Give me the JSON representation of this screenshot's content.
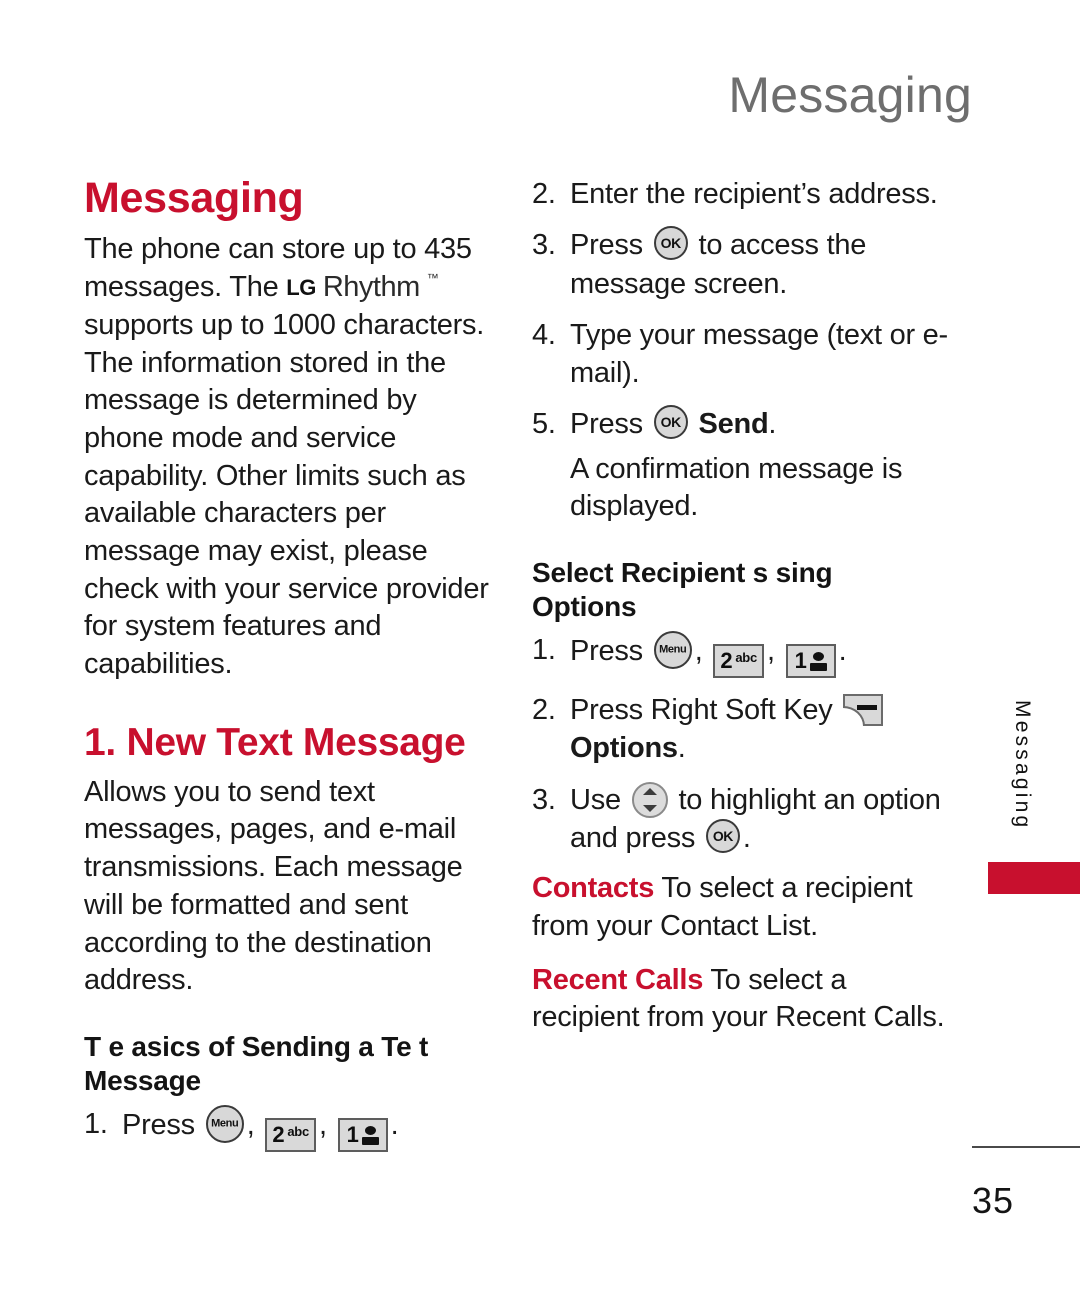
{
  "document": {
    "running_header": "Messaging",
    "page_number": "35",
    "side_tab_label": "Messaging",
    "accent_color": "#C8102E",
    "header_color": "#6E6E6E"
  },
  "left_column": {
    "section_title": "Messaging",
    "intro_before_logo": "The phone can store up to 435 messages. The",
    "logo": {
      "mark": "LG",
      "word": "Rhythm",
      "trademark": "™"
    },
    "intro_after_logo": "supports up to 1000 characters. The information stored in the message is determined by phone mode and service capability. Other limits such as available characters per message may exist, please check with your service provider for system features and capabilities.",
    "subsection_title": "1. New Text Message",
    "subsection_body": "Allows you to send text messages, pages, and e-mail transmissions. Each message will be formatted and sent according to the destination address.",
    "basics_heading": "T e  asics of Sending a Te t Message",
    "step_1": {
      "number": "1.",
      "lead": "Press",
      "key_menu_label": "Menu",
      "key_2_digit": "2",
      "key_2_sup": "abc",
      "key_1_digit": "1",
      "separator": ",",
      "period": "."
    }
  },
  "right_column": {
    "step_2": {
      "number": "2.",
      "text": "Enter the recipient’s address."
    },
    "step_3": {
      "number": "3.",
      "lead": "Press",
      "key_ok_label": "OK",
      "tail": "to access the message screen."
    },
    "step_4": {
      "number": "4.",
      "text": "Type your message (text or e-mail)."
    },
    "step_5": {
      "number": "5.",
      "lead": "Press",
      "key_ok_label": "OK",
      "bold_word": "Send",
      "period": ".",
      "note": "A confirmation message is displayed."
    },
    "select_heading_line1": "Select Recipient s    sing",
    "select_heading_line2": "Options",
    "opt_step_1": {
      "number": "1.",
      "lead": "Press",
      "key_menu_label": "Menu",
      "key_2_digit": "2",
      "key_2_sup": "abc",
      "key_1_digit": "1",
      "separator": ",",
      "period": "."
    },
    "opt_step_2": {
      "number": "2.",
      "lead": "Press Right Soft Key",
      "bold_word": "Options",
      "period": "."
    },
    "opt_step_3": {
      "number": "3.",
      "lead": "Use",
      "mid": "to highlight an option and press",
      "key_ok_label": "OK",
      "period": "."
    },
    "definitions": [
      {
        "term": "Contacts",
        "description": "To select a recipient from your Contact List."
      },
      {
        "term": "Recent Calls",
        "description": "To select a recipient from your Recent Calls."
      }
    ]
  }
}
